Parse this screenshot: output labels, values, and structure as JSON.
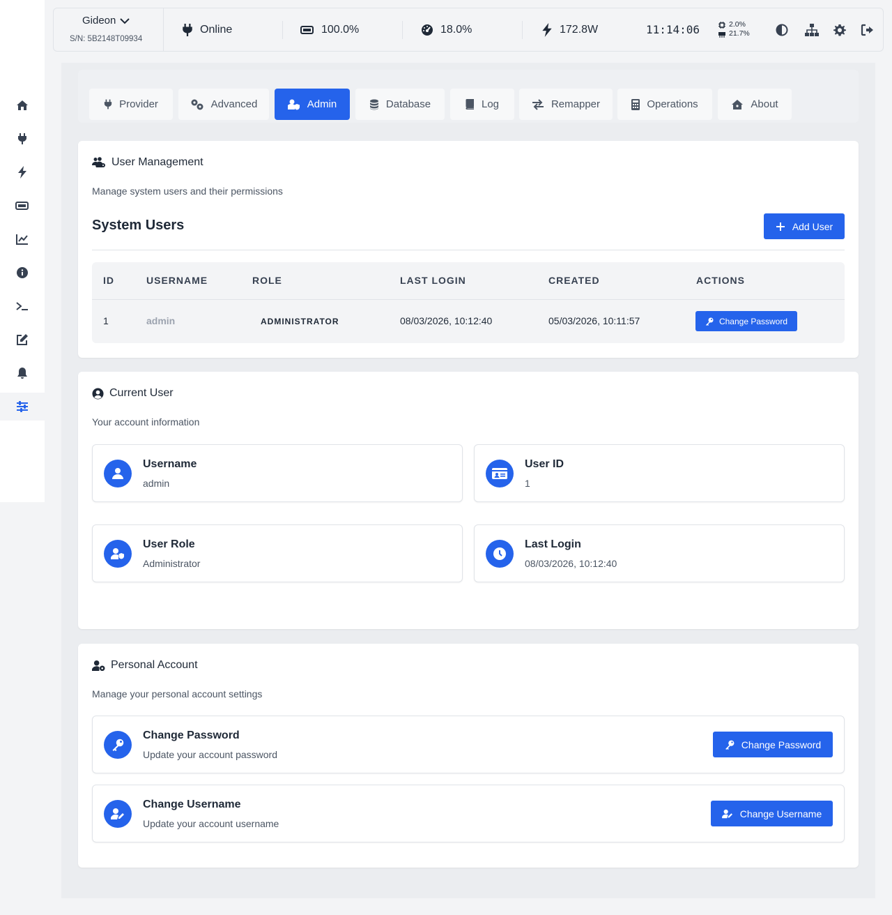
{
  "topbar": {
    "device_name": "Gideon",
    "serial": "S/N: 5B2148T09934",
    "status": "Online",
    "battery": "100.0%",
    "load": "18.0%",
    "power": "172.8W",
    "clock": "11:14:06",
    "cpu": "2.0%",
    "memory": "21.7%"
  },
  "sidebar": {
    "items": [
      "home-icon",
      "plug-icon",
      "bolt-icon",
      "battery-icon",
      "chart-line-icon",
      "info-icon",
      "terminal-icon",
      "edit-icon",
      "bell-icon",
      "sliders-icon"
    ],
    "active": "sliders-icon"
  },
  "tabs": [
    {
      "label": "Provider"
    },
    {
      "label": "Advanced"
    },
    {
      "label": "Admin"
    },
    {
      "label": "Database"
    },
    {
      "label": "Log"
    },
    {
      "label": "Remapper"
    },
    {
      "label": "Operations"
    },
    {
      "label": "About"
    }
  ],
  "active_tab": "Admin",
  "user_management": {
    "title": "User Management",
    "subtitle": "Manage system users and their permissions",
    "section_title": "System Users",
    "add_button": "Add User",
    "columns": [
      "ID",
      "USERNAME",
      "ROLE",
      "LAST LOGIN",
      "CREATED",
      "ACTIONS"
    ],
    "rows": [
      {
        "id": "1",
        "username": "admin",
        "role": "ADMINISTRATOR",
        "last_login": "08/03/2026, 10:12:40",
        "created": "05/03/2026, 10:11:57",
        "action": "Change Password"
      }
    ]
  },
  "current_user": {
    "title": "Current User",
    "subtitle": "Your account information",
    "fields": [
      {
        "label": "Username",
        "value": "admin"
      },
      {
        "label": "User ID",
        "value": "1"
      },
      {
        "label": "User Role",
        "value": "Administrator"
      },
      {
        "label": "Last Login",
        "value": "08/03/2026, 10:12:40"
      }
    ]
  },
  "personal_account": {
    "title": "Personal Account",
    "subtitle": "Manage your personal account settings",
    "actions": [
      {
        "title": "Change Password",
        "desc": "Update your account password",
        "button": "Change Password"
      },
      {
        "title": "Change Username",
        "desc": "Update your account username",
        "button": "Change Username"
      }
    ]
  },
  "colors": {
    "accent": "#2563eb",
    "background": "#f3f4f6",
    "text": "#1f2937"
  }
}
